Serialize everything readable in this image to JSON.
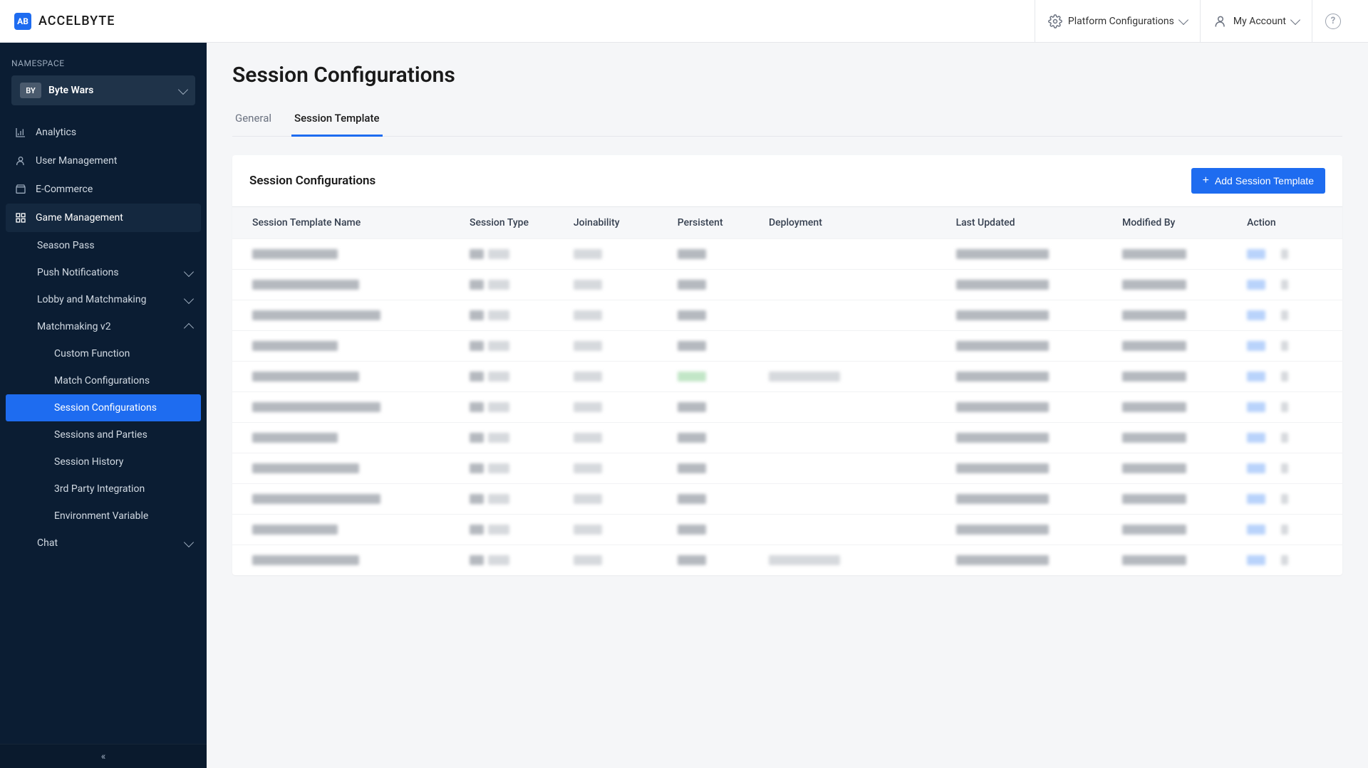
{
  "brand": {
    "name": "ACCELBYTE",
    "logo_letters": "AB"
  },
  "header": {
    "platform_configurations": "Platform Configurations",
    "my_account": "My Account"
  },
  "sidebar": {
    "namespace_label": "NAMESPACE",
    "namespace_badge": "BY",
    "namespace_name": "Byte Wars",
    "items": [
      {
        "id": "analytics",
        "label": "Analytics",
        "icon": "bars"
      },
      {
        "id": "user-management",
        "label": "User Management",
        "icon": "user"
      },
      {
        "id": "e-commerce",
        "label": "E-Commerce",
        "icon": "store"
      },
      {
        "id": "game-management",
        "label": "Game Management",
        "icon": "grid",
        "active_parent": true
      }
    ],
    "game_management_children": [
      {
        "id": "season-pass",
        "label": "Season Pass",
        "expandable": false
      },
      {
        "id": "push-notifications",
        "label": "Push Notifications",
        "expandable": true,
        "expanded": false
      },
      {
        "id": "lobby-matchmaking",
        "label": "Lobby and Matchmaking",
        "expandable": true,
        "expanded": false
      },
      {
        "id": "matchmaking-v2",
        "label": "Matchmaking v2",
        "expandable": true,
        "expanded": true
      }
    ],
    "matchmaking_children": [
      {
        "id": "custom-function",
        "label": "Custom Function"
      },
      {
        "id": "match-configurations",
        "label": "Match Configurations"
      },
      {
        "id": "session-configurations",
        "label": "Session Configurations",
        "active": true
      },
      {
        "id": "sessions-parties",
        "label": "Sessions and Parties"
      },
      {
        "id": "session-history",
        "label": "Session History"
      },
      {
        "id": "third-party-integration",
        "label": "3rd Party Integration"
      },
      {
        "id": "environment-variable",
        "label": "Environment Variable"
      }
    ],
    "chat_label": "Chat"
  },
  "page": {
    "title": "Session Configurations",
    "tabs": [
      {
        "id": "general",
        "label": "General",
        "active": false
      },
      {
        "id": "session-template",
        "label": "Session Template",
        "active": true
      }
    ],
    "card_title": "Session Configurations",
    "add_button": "Add Session Template",
    "columns": [
      "Session Template Name",
      "Session Type",
      "Joinability",
      "Persistent",
      "Deployment",
      "Last Updated",
      "Modified By",
      "Action"
    ],
    "row_count": 11
  }
}
